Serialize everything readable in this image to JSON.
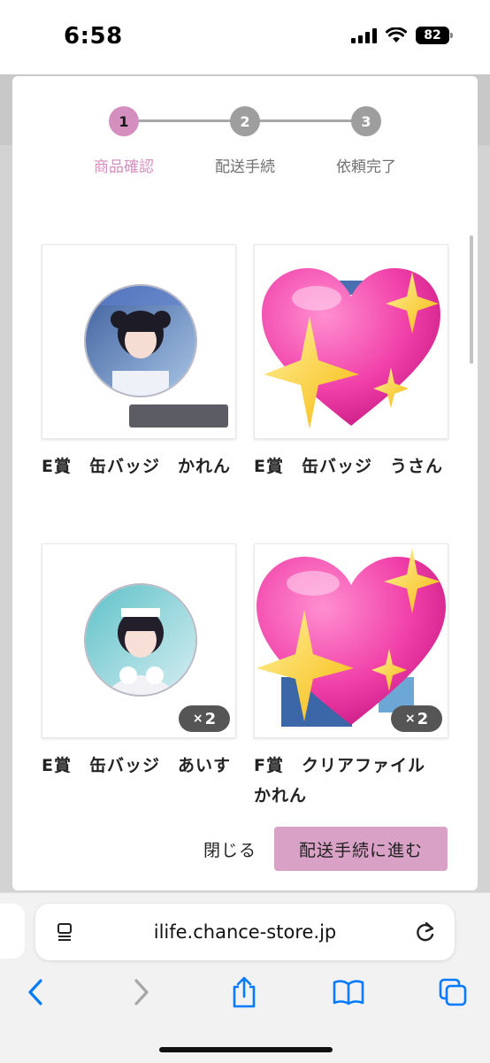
{
  "status_bar": {
    "time": "6:58",
    "battery": "82"
  },
  "stepper": {
    "steps": [
      {
        "number": "1",
        "label": "商品確認"
      },
      {
        "number": "2",
        "label": "配送手続"
      },
      {
        "number": "3",
        "label": "依頼完了"
      }
    ]
  },
  "items": [
    {
      "title": "E賞　缶バッジ　かれん",
      "quantity": ""
    },
    {
      "title": "E賞　缶バッジ　うさん",
      "quantity": ""
    },
    {
      "title": "E賞　缶バッジ　あいす",
      "quantity": "2"
    },
    {
      "title": "F賞　クリアファイル　かれん",
      "quantity": "2"
    }
  ],
  "quantity_prefix": "×",
  "buttons": {
    "close": "閉じる",
    "next": "配送手続に進む"
  },
  "browser": {
    "url": "ilife.chance-store.jp"
  },
  "colors": {
    "accent": "#d58fbf",
    "primary_button": "#d9a1c6",
    "ios_blue": "#007aff"
  },
  "icons": [
    "signal-icon",
    "wifi-icon",
    "battery-icon",
    "reader-icon",
    "reload-icon",
    "back-icon",
    "forward-icon",
    "share-icon",
    "bookmarks-icon",
    "tabs-icon",
    "sparkling-heart-icon"
  ]
}
